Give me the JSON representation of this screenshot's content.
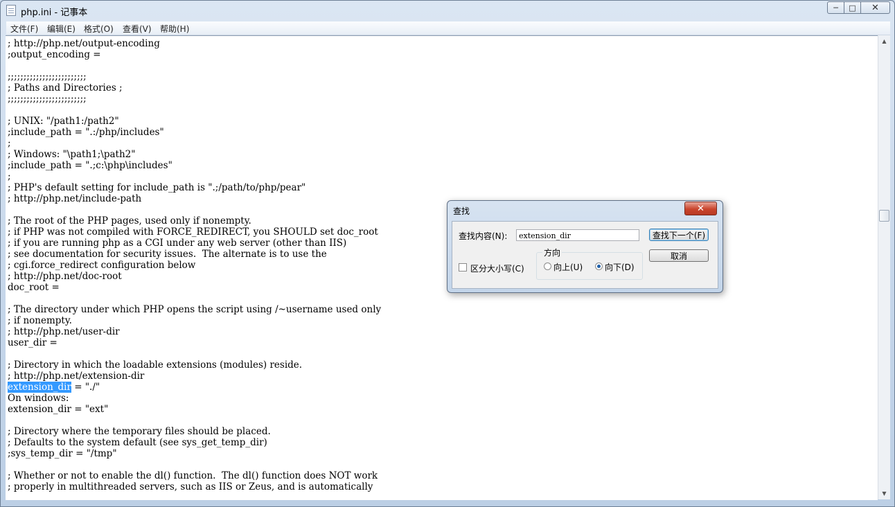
{
  "window": {
    "title": "php.ini - 记事本",
    "minimize": "─",
    "maximize": "□",
    "close": "✕"
  },
  "menu": [
    "文件(F)",
    "编辑(E)",
    "格式(O)",
    "查看(V)",
    "帮助(H)"
  ],
  "editor": {
    "lines": [
      "; http://php.net/output-encoding",
      ";output_encoding =",
      "",
      ";;;;;;;;;;;;;;;;;;;;;;;;;",
      "; Paths and Directories ;",
      ";;;;;;;;;;;;;;;;;;;;;;;;;",
      "",
      "; UNIX: \"/path1:/path2\"",
      ";include_path = \".:/php/includes\"",
      ";",
      "; Windows: \"\\path1;\\path2\"",
      ";include_path = \".;c:\\php\\includes\"",
      ";",
      "; PHP's default setting for include_path is \".;/path/to/php/pear\"",
      "; http://php.net/include-path",
      "",
      "; The root of the PHP pages, used only if nonempty.",
      "; if PHP was not compiled with FORCE_REDIRECT, you SHOULD set doc_root",
      "; if you are running php as a CGI under any web server (other than IIS)",
      "; see documentation for security issues.  The alternate is to use the",
      "; cgi.force_redirect configuration below",
      "; http://php.net/doc-root",
      "doc_root =",
      "",
      "; The directory under which PHP opens the script using /~username used only",
      "; if nonempty.",
      "; http://php.net/user-dir",
      "user_dir =",
      "",
      "; Directory in which the loadable extensions (modules) reside.",
      "; http://php.net/extension-dir",
      "__SEL__",
      "On windows:",
      "extension_dir = \"ext\"",
      "",
      "; Directory where the temporary files should be placed.",
      "; Defaults to the system default (see sys_get_temp_dir)",
      ";sys_temp_dir = \"/tmp\"",
      "",
      "; Whether or not to enable the dl() function.  The dl() function does NOT work",
      "; properly in multithreaded servers, such as IIS or Zeus, and is automatically"
    ],
    "selected_text": "extension_dir",
    "selected_rest": " = \"./\""
  },
  "find_dialog": {
    "title": "查找",
    "close": "✕",
    "find_label": "查找内容(N):",
    "find_value": "extension_dir",
    "find_next": "查找下一个(F)",
    "cancel": "取消",
    "direction_label": "方向",
    "up": "向上(U)",
    "down": "向下(D)",
    "direction_selected": "down",
    "match_case": "区分大小写(C)",
    "match_case_checked": false
  },
  "colors": {
    "selection": "#3399ff",
    "title_bar": "#c5d6ea"
  }
}
